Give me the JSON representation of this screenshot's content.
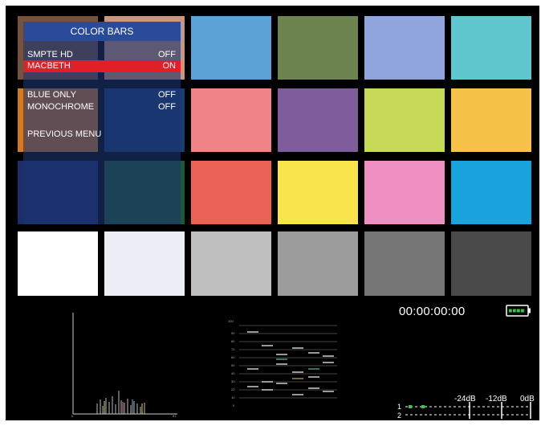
{
  "menu": {
    "title": "COLOR BARS",
    "items": [
      {
        "label": "SMPTE HD",
        "value": "OFF",
        "selected": false
      },
      {
        "label": "MACBETH",
        "value": "ON",
        "selected": true
      },
      {
        "label": "BLUE ONLY",
        "value": "OFF",
        "selected": false
      },
      {
        "label": "MONOCHROME",
        "value": "OFF",
        "selected": false
      },
      {
        "label": "PREVIOUS MENU",
        "value": "",
        "selected": false
      }
    ]
  },
  "color_chart": {
    "rows": [
      [
        "#73533f",
        "#c9977f",
        "#5da2d6",
        "#6e8450",
        "#90a5db",
        "#5ec6cc"
      ],
      [
        "#d27a28",
        "#193c73",
        "#ef8385",
        "#7f5d9c",
        "#c7da58",
        "#f7c248"
      ],
      [
        "#1b2d6a",
        "#1b5b30",
        "#e96255",
        "#f8e44b",
        "#ee8fc2",
        "#18a3dd"
      ],
      [
        "#ffffff",
        "#ebeef5",
        "#bfbfbf",
        "#9c9c9c",
        "#767676",
        "#4a4a4a"
      ]
    ]
  },
  "status": {
    "timecode": "00:00:00:00",
    "battery_icon": "battery-full-icon",
    "battery_color": "#2ecc40"
  },
  "audio": {
    "scale_labels": [
      "-24dB",
      "-12dB",
      "0dB"
    ],
    "channels": [
      "1",
      "2"
    ],
    "channel_1_level": 0.25
  },
  "colors": {
    "menu_selected": "#e01f26",
    "menu_title": "#2a4a9a"
  }
}
